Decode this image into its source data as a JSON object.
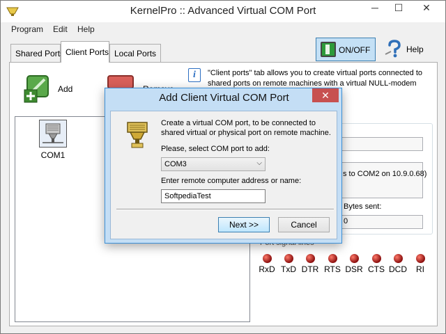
{
  "window": {
    "title": "KernelPro :: Advanced Virtual COM Port",
    "minimize": "─",
    "maximize": "☐",
    "close": "✕"
  },
  "menu": [
    "Program",
    "Edit",
    "Help"
  ],
  "tabs": [
    "Shared Ports",
    "Client Ports",
    "Local Ports"
  ],
  "active_tab": "Client Ports",
  "toolbar": {
    "onoff_label": "ON/OFF",
    "help_label": "Help",
    "add_label": "Add",
    "remove_label": "Remove"
  },
  "info": {
    "text": "\"Client ports\" tab allows you to create virtual ports connected to shared ports on remote machines with a virtual NULL-modem cable."
  },
  "ports": [
    {
      "name": "COM1",
      "icon": "serial-port-icon"
    }
  ],
  "details": {
    "connection_fragment": "s to COM2 on 10.9.0.68)",
    "bytes_sent_label": "Bytes sent:",
    "bytes_sent_value": "0",
    "signals_label": "Port signal lines",
    "signals": [
      "RxD",
      "TxD",
      "DTR",
      "RTS",
      "DSR",
      "CTS",
      "DCD",
      "RI"
    ]
  },
  "dialog": {
    "title": "Add Client Virtual COM Port",
    "close": "✕",
    "description": "Create a virtual COM port, to be connected to shared virtual or physical port on remote machine.",
    "select_label": "Please, select COM port to add:",
    "selected_port": "COM3",
    "address_label": "Enter remote computer address or name:",
    "address_value": "SoftpediaTest",
    "next_button": "Next >>",
    "cancel_button": "Cancel"
  },
  "colors": {
    "accent": "#3b8fd6",
    "led": "#8a0e0e",
    "onoff": "#2d9b3a"
  }
}
